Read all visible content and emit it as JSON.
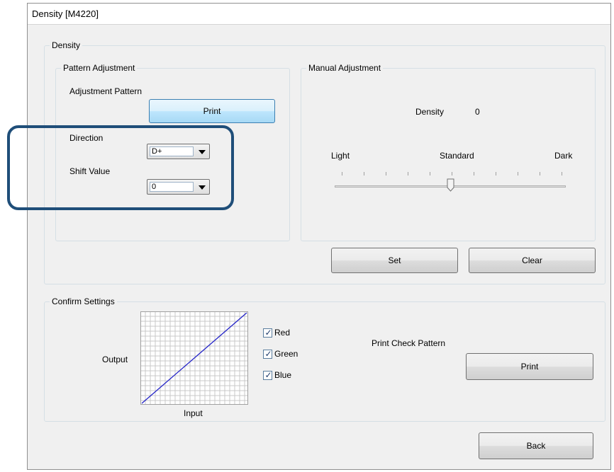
{
  "window": {
    "title": "Density [M4220]"
  },
  "density_group": {
    "label": "Density"
  },
  "pattern_adjustment": {
    "label": "Pattern Adjustment",
    "adjustment_pattern_label": "Adjustment Pattern",
    "print_button": "Print",
    "direction_label": "Direction",
    "direction_value": "D+",
    "shift_value_label": "Shift Value",
    "shift_value": "0"
  },
  "manual_adjustment": {
    "label": "Manual Adjustment",
    "density_label": "Density",
    "density_value": "0",
    "light_label": "Light",
    "standard_label": "Standard",
    "dark_label": "Dark",
    "slider_position_fraction": 0.5
  },
  "buttons": {
    "set": "Set",
    "clear": "Clear",
    "back": "Back"
  },
  "confirm_settings": {
    "label": "Confirm Settings",
    "output_label": "Output",
    "input_label": "Input",
    "checkboxes": [
      {
        "label": "Red",
        "checked": true
      },
      {
        "label": "Green",
        "checked": true
      },
      {
        "label": "Blue",
        "checked": true
      }
    ],
    "print_check_pattern_label": "Print Check Pattern",
    "print_button": "Print",
    "curve_color": "#2323c8"
  },
  "colors": {
    "highlight": "#1f4e79",
    "active_button_border": "#3c7fb1"
  }
}
